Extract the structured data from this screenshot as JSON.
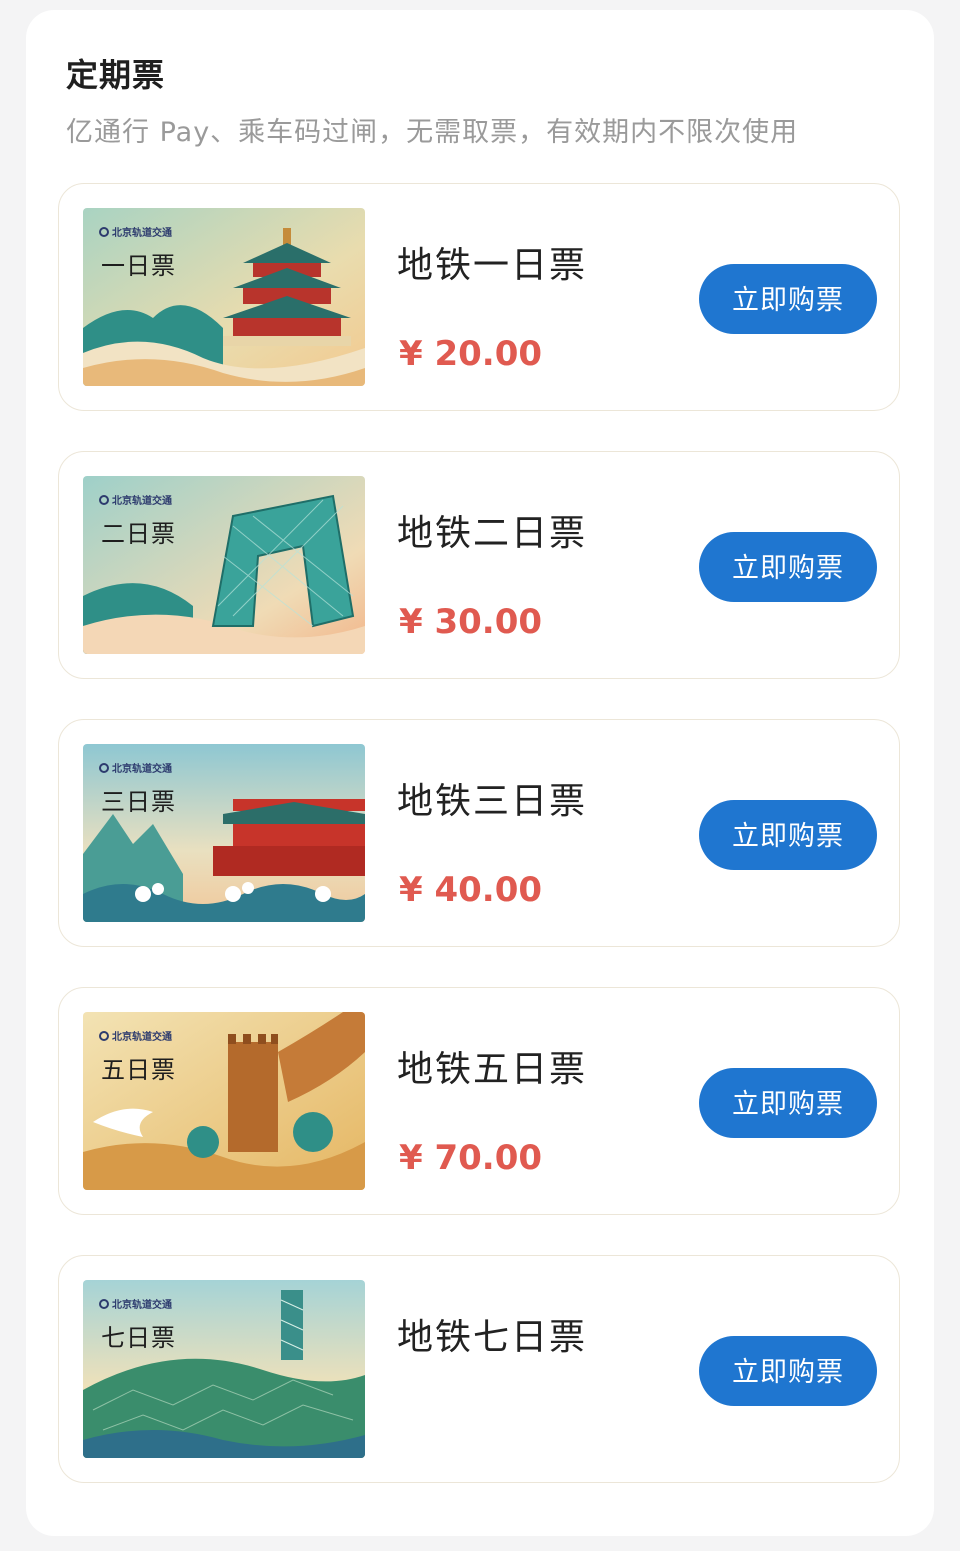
{
  "section": {
    "title": "定期票",
    "subtitle": "亿通行 Pay、乘车码过闸，无需取票，有效期内不限次使用"
  },
  "art_brand_text": "北京轨道交通",
  "tickets": [
    {
      "art_label": "一日票",
      "name": "地铁一日票",
      "price": "¥ 20.00",
      "button": "立即购票",
      "art_icon": "temple-of-heaven-illustration"
    },
    {
      "art_label": "二日票",
      "name": "地铁二日票",
      "price": "¥ 30.00",
      "button": "立即购票",
      "art_icon": "cctv-tower-illustration"
    },
    {
      "art_label": "三日票",
      "name": "地铁三日票",
      "price": "¥ 40.00",
      "button": "立即购票",
      "art_icon": "tiananmen-illustration"
    },
    {
      "art_label": "五日票",
      "name": "地铁五日票",
      "price": "¥ 70.00",
      "button": "立即购票",
      "art_icon": "great-wall-illustration"
    },
    {
      "art_label": "七日票",
      "name": "地铁七日票",
      "price": "",
      "button": "立即购票",
      "art_icon": "bird-nest-illustration"
    }
  ],
  "colors": {
    "accent": "#1f76d0",
    "price": "#e05a50",
    "card_border": "#ece6d8"
  }
}
